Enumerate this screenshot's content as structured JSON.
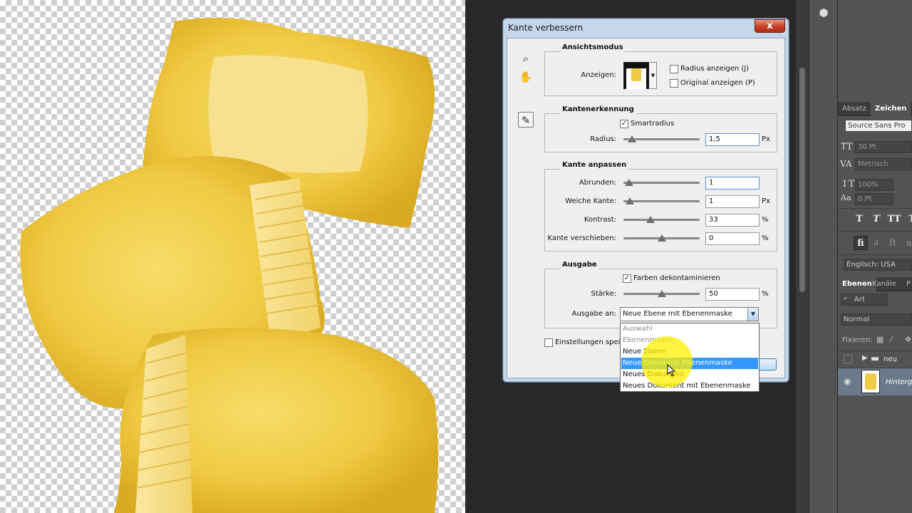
{
  "dialog": {
    "title": "Kante verbessern",
    "close_label": "x",
    "ansichtsmodus": {
      "title": "Ansichtsmodus",
      "anzeigen_label": "Anzeigen:",
      "radius_anzeigen": "Radius anzeigen (J)",
      "original_anzeigen": "Original anzeigen (P)"
    },
    "kantenerkennung": {
      "title": "Kantenerkennung",
      "smartradius_label": "Smartradius",
      "smartradius_checked": true,
      "radius_label": "Radius:",
      "radius_value": "1,5",
      "radius_unit": "Px",
      "radius_slider": 0.05
    },
    "kante_anpassen": {
      "title": "Kante anpassen",
      "abrunden_label": "Abrunden:",
      "abrunden_value": "1",
      "abrunden_slider": 0.01,
      "weiche_label": "Weiche Kante:",
      "weiche_value": "1",
      "weiche_unit": "Px",
      "weiche_slider": 0.02,
      "kontrast_label": "Kontrast:",
      "kontrast_value": "33",
      "kontrast_unit": "%",
      "kontrast_slider": 0.33,
      "verschieben_label": "Kante verschieben:",
      "verschieben_value": "0",
      "verschieben_unit": "%",
      "verschieben_slider": 0.5
    },
    "ausgabe": {
      "title": "Ausgabe",
      "farben_label": "Farben dekontaminieren",
      "farben_checked": true,
      "staerke_label": "Stärke:",
      "staerke_value": "50",
      "staerke_unit": "%",
      "staerke_slider": 0.5,
      "ausgabe_an_label": "Ausgabe an:",
      "ausgabe_an_value": "Neue Ebene mit Ebenenmaske"
    },
    "einstellungen_label": "Einstellungen speich"
  },
  "dropdown": {
    "items": [
      {
        "label": "Auswahl",
        "state": "disabled"
      },
      {
        "label": "Ebenenmaske",
        "state": "disabled"
      },
      {
        "label": "Neue Ebene",
        "state": "normal"
      },
      {
        "label": "Neue Ebene mit Ebenenmaske",
        "state": "selected"
      },
      {
        "label": "Neues Dokument",
        "state": "normal"
      },
      {
        "label": "Neues Dokument mit Ebenenmaske",
        "state": "normal"
      }
    ]
  },
  "panel": {
    "tabs_top": [
      "Absatz",
      "Zeichen"
    ],
    "font_family": "Source Sans Pro",
    "font_size": "30 Pt",
    "kerning": "Metrisch",
    "scale": "100%",
    "baseline": "0 Pt",
    "type_buttons": [
      "T",
      "T",
      "TT",
      "T"
    ],
    "ligature_button": "fi",
    "language": "Englisch: USA",
    "tabs_layers": [
      "Ebenen",
      "Kanäle",
      "P"
    ],
    "filter_label": "Art",
    "blend_mode": "Normal",
    "fixieren_label": "Fixieren:",
    "layer_group_name": "neu",
    "layer_bg_name": "Hintergr"
  },
  "colors": {
    "selection": "#3399ff",
    "highlight": "#fff000",
    "pasta": "#f4d24e"
  }
}
